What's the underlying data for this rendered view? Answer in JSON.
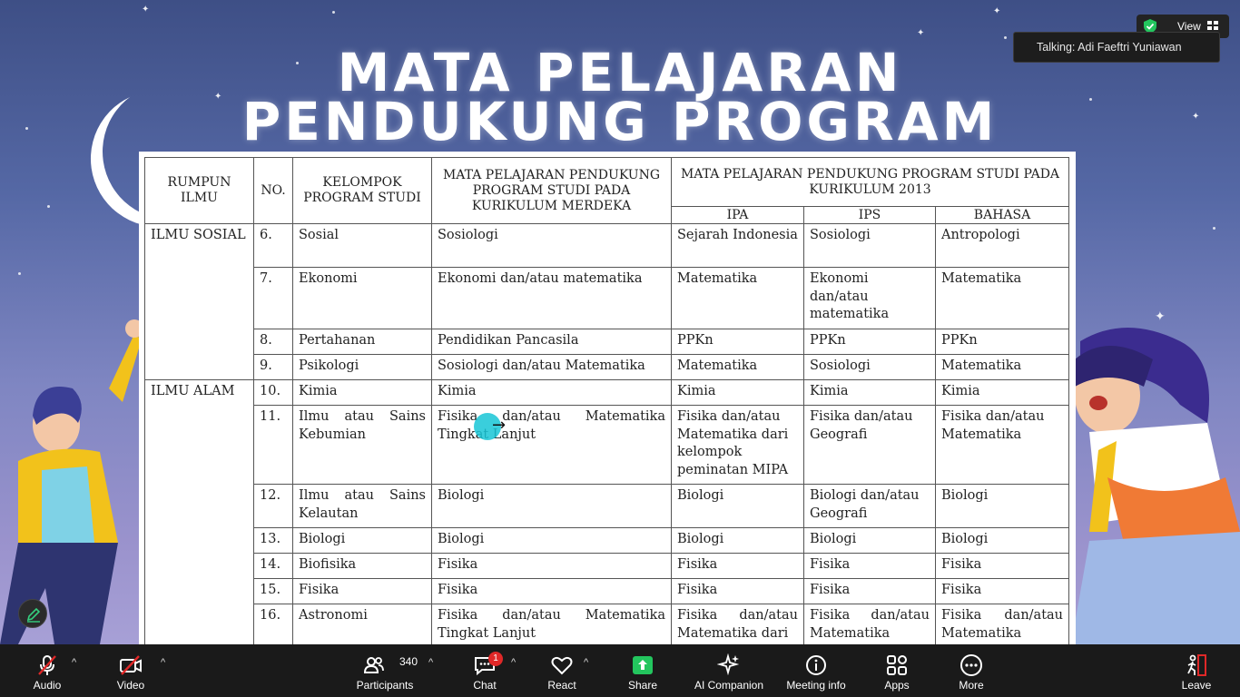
{
  "slide": {
    "title_line1": "MATA PELAJARAN",
    "title_line2": "PENDUKUNG PROGRAM"
  },
  "table": {
    "headers": {
      "rumpun": "RUMPUN ILMU",
      "no": "NO.",
      "kelompok": "KELOMPOK PROGRAM STUDI",
      "merdeka": "MATA PELAJARAN PENDUKUNG PROGRAM STUDI PADA KURIKULUM MERDEKA",
      "k13": "MATA PELAJARAN PENDUKUNG PROGRAM STUDI PADA KURIKULUM 2013",
      "ipa": "IPA",
      "ips": "IPS",
      "bahasa": "BAHASA"
    },
    "groups": {
      "sosial": "ILMU SOSIAL",
      "alam": "ILMU ALAM"
    },
    "rows": [
      {
        "no": "6.",
        "kelompok": "Sosial",
        "merdeka": "Sosiologi",
        "ipa": "Sejarah Indonesia",
        "ips": "Sosiologi",
        "bahasa": "Antropologi"
      },
      {
        "no": "7.",
        "kelompok": "Ekonomi",
        "merdeka": "Ekonomi dan/atau matematika",
        "ipa": "Matematika",
        "ips": "Ekonomi dan/atau matematika",
        "bahasa": "Matematika"
      },
      {
        "no": "8.",
        "kelompok": "Pertahanan",
        "merdeka": "Pendidikan Pancasila",
        "ipa": "PPKn",
        "ips": "PPKn",
        "bahasa": "PPKn"
      },
      {
        "no": "9.",
        "kelompok": "Psikologi",
        "merdeka": "Sosiologi dan/atau Matematika",
        "ipa": "Matematika",
        "ips": "Sosiologi",
        "bahasa": "Matematika"
      },
      {
        "no": "10.",
        "kelompok": "Kimia",
        "merdeka": "Kimia",
        "ipa": "Kimia",
        "ips": "Kimia",
        "bahasa": "Kimia"
      },
      {
        "no": "11.",
        "kelompok": "Ilmu atau Sains Kebumian",
        "merdeka": "Fisika dan/atau Matematika Tingkat Lanjut",
        "ipa": "Fisika dan/atau Matematika dari kelompok peminatan MIPA",
        "ips": "Fisika dan/atau Geografi",
        "bahasa": "Fisika dan/atau Matematika"
      },
      {
        "no": "12.",
        "kelompok": "Ilmu atau Sains Kelautan",
        "merdeka": "Biologi",
        "ipa": "Biologi",
        "ips": "Biologi dan/atau Geografi",
        "bahasa": "Biologi"
      },
      {
        "no": "13.",
        "kelompok": "Biologi",
        "merdeka": "Biologi",
        "ipa": "Biologi",
        "ips": "Biologi",
        "bahasa": "Biologi"
      },
      {
        "no": "14.",
        "kelompok": "Biofisika",
        "merdeka": "Fisika",
        "ipa": "Fisika",
        "ips": "Fisika",
        "bahasa": "Fisika"
      },
      {
        "no": "15.",
        "kelompok": "Fisika",
        "merdeka": "Fisika",
        "ipa": "Fisika",
        "ips": "Fisika",
        "bahasa": "Fisika"
      },
      {
        "no": "16.",
        "kelompok": "Astronomi",
        "merdeka": "Fisika dan/atau Matematika Tingkat Lanjut",
        "ipa": "Fisika dan/atau Matematika dari",
        "ips": "Fisika dan/atau Matematika",
        "bahasa": "Fisika dan/atau Matematika"
      }
    ]
  },
  "meeting": {
    "view_label": "View",
    "talking_text": "Talking: Adi Faeftri Yuniawan"
  },
  "toolbar": {
    "audio": "Audio",
    "video": "Video",
    "participants": "Participants",
    "participants_count": "340",
    "chat": "Chat",
    "chat_badge": "1",
    "react": "React",
    "share": "Share",
    "ai_companion": "AI Companion",
    "meeting_info": "Meeting info",
    "apps": "Apps",
    "more": "More",
    "leave": "Leave"
  },
  "colors": {
    "share_green": "#23c55e",
    "leave_red": "#e02828",
    "pointer_cyan": "#18c6d6"
  }
}
